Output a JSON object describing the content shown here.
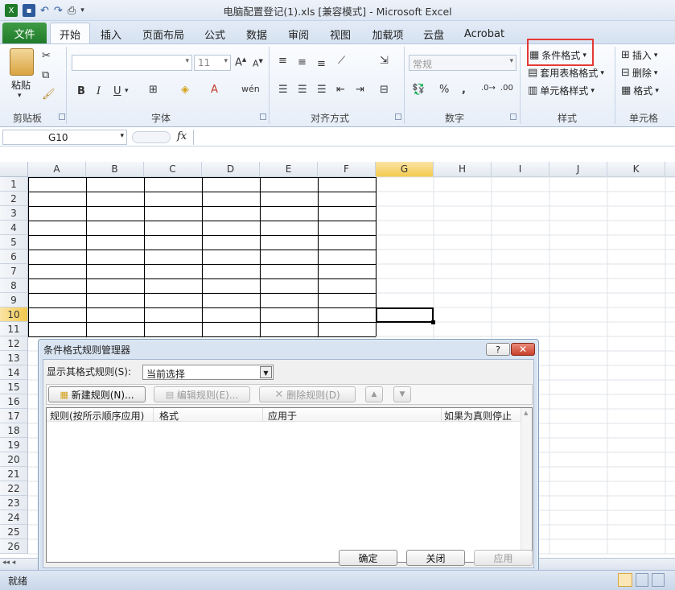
{
  "window": {
    "title": "电脑配置登记(1).xls  [兼容模式]  -  Microsoft Excel"
  },
  "tabs": [
    "文件",
    "开始",
    "插入",
    "页面布局",
    "公式",
    "数据",
    "审阅",
    "视图",
    "加载项",
    "云盘",
    "Acrobat"
  ],
  "ribbon": {
    "paste_label": "粘贴",
    "clipboard_label": "剪贴板",
    "font_label": "字体",
    "font_size": "11",
    "align_label": "对齐方式",
    "number_label": "数字",
    "number_format": "常规",
    "styles_label": "样式",
    "conditional_format": "条件格式",
    "table_format": "套用表格格式",
    "cell_styles": "单元格样式",
    "cells_label": "单元格",
    "insert": "插入",
    "delete": "删除",
    "format": "格式"
  },
  "formula_bar": {
    "name_box": "G10",
    "fx": "fx"
  },
  "columns": [
    "A",
    "B",
    "C",
    "D",
    "E",
    "F",
    "G",
    "H",
    "I",
    "J",
    "K"
  ],
  "rows": [
    "1",
    "2",
    "3",
    "4",
    "5",
    "6",
    "7",
    "8",
    "9",
    "10",
    "11",
    "12",
    "13",
    "14",
    "15",
    "16",
    "17",
    "18",
    "19",
    "20",
    "21",
    "22",
    "23",
    "24",
    "25",
    "26"
  ],
  "dialog": {
    "title": "条件格式规则管理器",
    "show_rules_label": "显示其格式规则(S):",
    "show_rules_value": "当前选择",
    "new_rule": "新建规则(N)...",
    "edit_rule": "编辑规则(E)...",
    "delete_rule": "删除规则(D)",
    "columns": [
      "规则(按所示顺序应用)",
      "格式",
      "应用于",
      "如果为真则停止"
    ],
    "ok": "确定",
    "close": "关闭",
    "apply": "应用"
  },
  "status": {
    "ready": "就绪"
  },
  "colors": {
    "file_tab": "#2a8a33",
    "highlight": "#e53935",
    "active_cell": "#f2c94c"
  }
}
